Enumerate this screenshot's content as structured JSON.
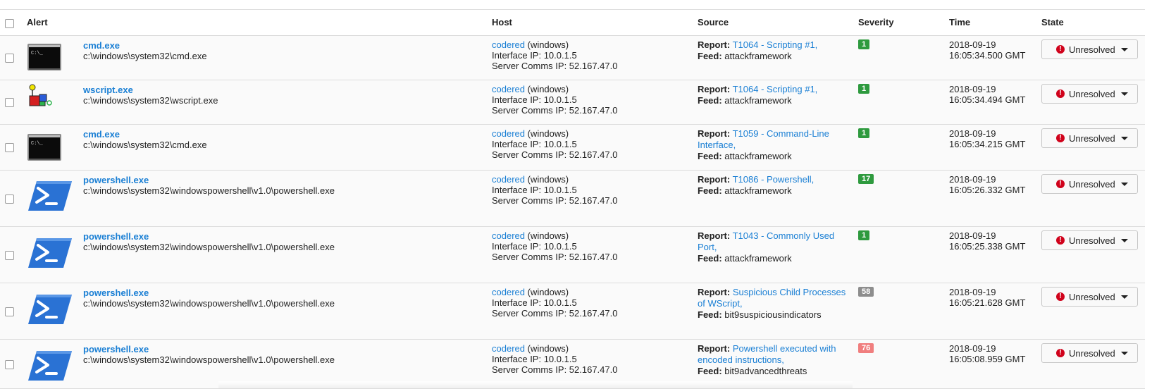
{
  "header": {
    "alert": "Alert",
    "host": "Host",
    "source": "Source",
    "severity": "Severity",
    "time": "Time",
    "state": "State"
  },
  "severity_colors": {
    "low": "#2e9a3e",
    "medium": "#8d8d8d",
    "high": "#f07e7e"
  },
  "rows": [
    {
      "icon": "cmd-icon",
      "name": "cmd.exe",
      "path": "c:\\windows\\system32\\cmd.exe",
      "host_name": "codered",
      "host_os": " (windows)",
      "interface_ip": "Interface IP: 10.0.1.5",
      "server_ip": "Server Comms IP: 52.167.47.0",
      "report_label": "Report:",
      "report": "T1064 - Scripting #1,",
      "feed_label": "Feed:",
      "feed": "attackframework",
      "severity": "1",
      "date": "2018-09-19",
      "time": "16:05:34.500 GMT",
      "state": "Unresolved"
    },
    {
      "icon": "wscript-icon",
      "name": "wscript.exe",
      "path": "c:\\windows\\system32\\wscript.exe",
      "host_name": "codered",
      "host_os": " (windows)",
      "interface_ip": "Interface IP: 10.0.1.5",
      "server_ip": "Server Comms IP: 52.167.47.0",
      "report_label": "Report:",
      "report": "T1064 - Scripting #1,",
      "feed_label": "Feed:",
      "feed": "attackframework",
      "severity": "1",
      "date": "2018-09-19",
      "time": "16:05:34.494 GMT",
      "state": "Unresolved"
    },
    {
      "icon": "cmd-icon",
      "name": "cmd.exe",
      "path": "c:\\windows\\system32\\cmd.exe",
      "host_name": "codered",
      "host_os": " (windows)",
      "interface_ip": "Interface IP: 10.0.1.5",
      "server_ip": "Server Comms IP: 52.167.47.0",
      "report_label": "Report:",
      "report": "T1059 - Command-Line Interface,",
      "feed_label": "Feed:",
      "feed": "attackframework",
      "severity": "1",
      "date": "2018-09-19",
      "time": "16:05:34.215 GMT",
      "state": "Unresolved"
    },
    {
      "icon": "powershell-icon",
      "name": "powershell.exe",
      "path": "c:\\windows\\system32\\windowspowershell\\v1.0\\powershell.exe",
      "host_name": "codered",
      "host_os": " (windows)",
      "interface_ip": "Interface IP: 10.0.1.5",
      "server_ip": "Server Comms IP: 52.167.47.0",
      "report_label": "Report:",
      "report": "T1086 - Powershell,",
      "feed_label": "Feed:",
      "feed": "attackframework",
      "severity": "17",
      "date": "2018-09-19",
      "time": "16:05:26.332 GMT",
      "state": "Unresolved"
    },
    {
      "icon": "powershell-icon",
      "name": "powershell.exe",
      "path": "c:\\windows\\system32\\windowspowershell\\v1.0\\powershell.exe",
      "host_name": "codered",
      "host_os": " (windows)",
      "interface_ip": "Interface IP: 10.0.1.5",
      "server_ip": "Server Comms IP: 52.167.47.0",
      "report_label": "Report:",
      "report": "T1043 - Commonly Used Port,",
      "feed_label": "Feed:",
      "feed": "attackframework",
      "severity": "1",
      "date": "2018-09-19",
      "time": "16:05:25.338 GMT",
      "state": "Unresolved"
    },
    {
      "icon": "powershell-icon",
      "name": "powershell.exe",
      "path": "c:\\windows\\system32\\windowspowershell\\v1.0\\powershell.exe",
      "host_name": "codered",
      "host_os": " (windows)",
      "interface_ip": "Interface IP: 10.0.1.5",
      "server_ip": "Server Comms IP: 52.167.47.0",
      "report_label": "Report:",
      "report": "Suspicious Child Processes of WScript,",
      "feed_label": "Feed:",
      "feed": "bit9suspiciousindicators",
      "severity": "58",
      "date": "2018-09-19",
      "time": "16:05:21.628 GMT",
      "state": "Unresolved"
    },
    {
      "icon": "powershell-icon",
      "name": "powershell.exe",
      "path": "c:\\windows\\system32\\windowspowershell\\v1.0\\powershell.exe",
      "host_name": "codered",
      "host_os": " (windows)",
      "interface_ip": "Interface IP: 10.0.1.5",
      "server_ip": "Server Comms IP: 52.167.47.0",
      "report_label": "Report:",
      "report": "Powershell executed with encoded instructions,",
      "feed_label": "Feed:",
      "feed": "bit9advancedthreats",
      "severity": "76",
      "date": "2018-09-19",
      "time": "16:05:08.959 GMT",
      "state": "Unresolved"
    }
  ]
}
